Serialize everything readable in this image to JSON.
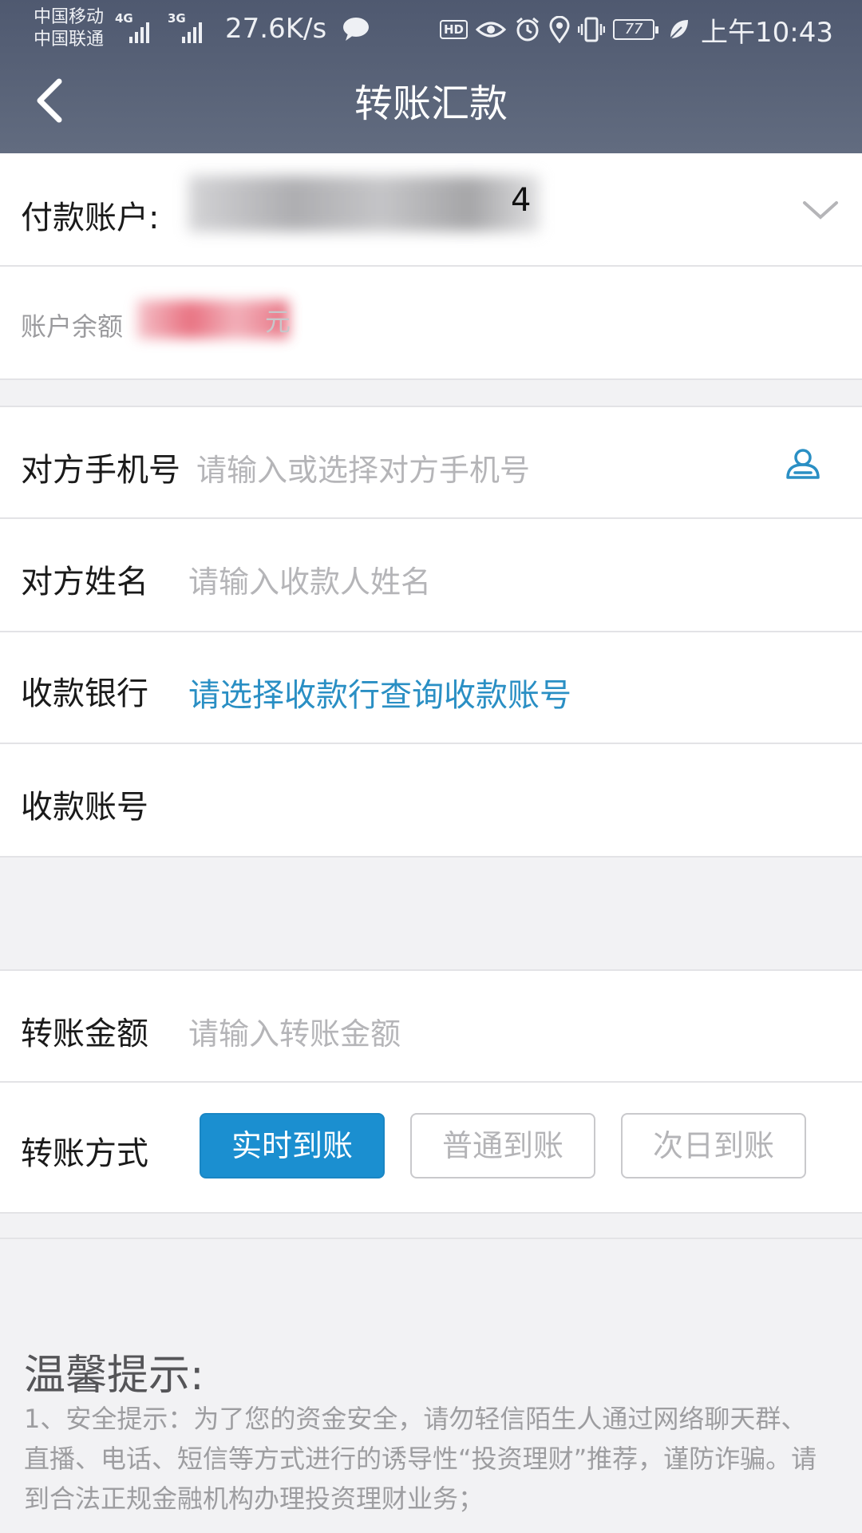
{
  "status_bar": {
    "carrier_1": "中国移动",
    "carrier_2": "中国联通",
    "net_1": "4G",
    "net_2": "3G",
    "speed": "27.6K/s",
    "hd": "HD",
    "battery_level": "77",
    "time": "上午10:43"
  },
  "header": {
    "title": "转账汇款",
    "back_icon": "chevron-left-icon"
  },
  "form": {
    "payment_account": {
      "label": "付款账户:",
      "value_visible_tail": "4",
      "icon": "chevron-down-icon"
    },
    "balance": {
      "label": "账户余额",
      "unit": "元"
    },
    "payee_phone": {
      "label": "对方手机号",
      "placeholder": "请输入或选择对方手机号",
      "icon": "contacts-icon"
    },
    "payee_name": {
      "label": "对方姓名",
      "placeholder": "请输入收款人姓名"
    },
    "receiving_bank": {
      "label": "收款银行",
      "link": "请选择收款行查询收款账号"
    },
    "receiving_account": {
      "label": "收款账号",
      "value": ""
    },
    "amount": {
      "label": "转账金额",
      "placeholder": "请输入转账金额"
    },
    "method": {
      "label": "转账方式",
      "options": [
        "实时到账",
        "普通到账",
        "次日到账"
      ],
      "selected": "实时到账"
    }
  },
  "tips": {
    "title": "温馨提示:",
    "text": "1、安全提示：为了您的资金安全，请勿轻信陌生人通过网络聊天群、直播、电话、短信等方式进行的诱导性“投资理财”推荐，谨防诈骗。请到合法正规金融机构办理投资理财业务；"
  },
  "colors": {
    "header_bg": "#56607a",
    "accent_blue": "#1b8fd0",
    "link_blue": "#2a8fc4",
    "balance_red": "#e55a6c"
  }
}
